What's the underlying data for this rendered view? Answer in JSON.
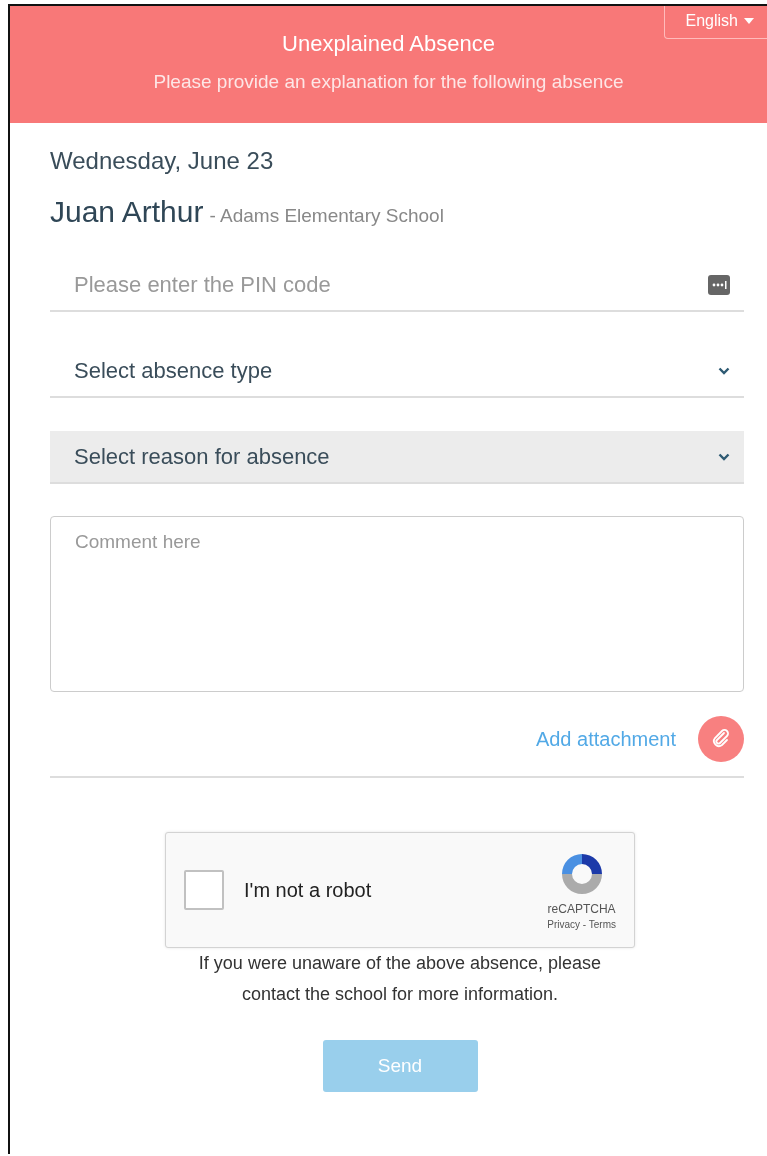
{
  "header": {
    "title": "Unexplained Absence",
    "subtitle": "Please provide an explanation for the following absence",
    "language": "English"
  },
  "date": "Wednesday, June 23",
  "student": {
    "name": "Juan Arthur",
    "school": "- Adams Elementary School"
  },
  "pin_field": {
    "placeholder": "Please enter the PIN code"
  },
  "selects": [
    {
      "placeholder": "Select absence type",
      "disabled": false
    },
    {
      "placeholder": "Select reason for absence",
      "disabled": true
    }
  ],
  "comment": {
    "placeholder": "Comment here"
  },
  "attachment": {
    "label": "Add attachment"
  },
  "captcha": {
    "label": "I'm not a robot",
    "checked": false,
    "brand": "reCAPTCHA",
    "privacy": "Privacy",
    "separator": "-",
    "terms": "Terms"
  },
  "notice": "If you were unaware of the above absence, please contact the school for more information.",
  "send": {
    "label": "Send",
    "disabled": true
  }
}
